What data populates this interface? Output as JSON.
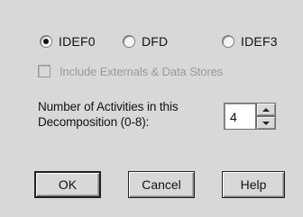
{
  "methodology": {
    "options": [
      {
        "label": "IDEF0",
        "selected": true
      },
      {
        "label": "DFD",
        "selected": false
      },
      {
        "label": "IDEF3",
        "selected": false
      }
    ]
  },
  "include_externals": {
    "label": "Include Externals & Data Stores",
    "checked": false,
    "disabled": true
  },
  "activities": {
    "label_line1": "Number of Activities in this",
    "label_line2": "Decomposition (0-8):",
    "value": "4"
  },
  "buttons": {
    "ok": "OK",
    "cancel": "Cancel",
    "help": "Help"
  }
}
